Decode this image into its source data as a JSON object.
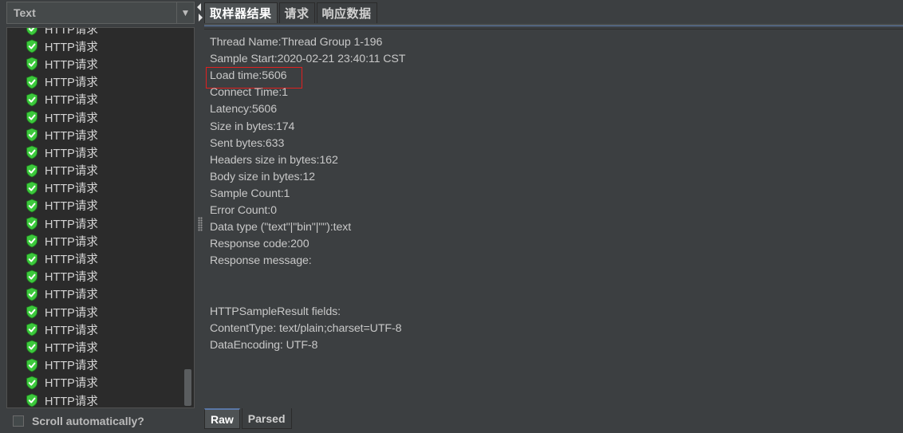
{
  "renderer": {
    "selected": "Text"
  },
  "tree": {
    "items": [
      {
        "label": "HTTP请求"
      },
      {
        "label": "HTTP请求"
      },
      {
        "label": "HTTP请求"
      },
      {
        "label": "HTTP请求"
      },
      {
        "label": "HTTP请求"
      },
      {
        "label": "HTTP请求"
      },
      {
        "label": "HTTP请求"
      },
      {
        "label": "HTTP请求"
      },
      {
        "label": "HTTP请求"
      },
      {
        "label": "HTTP请求"
      },
      {
        "label": "HTTP请求"
      },
      {
        "label": "HTTP请求"
      },
      {
        "label": "HTTP请求"
      },
      {
        "label": "HTTP请求"
      },
      {
        "label": "HTTP请求"
      },
      {
        "label": "HTTP请求"
      },
      {
        "label": "HTTP请求"
      },
      {
        "label": "HTTP请求"
      },
      {
        "label": "HTTP请求"
      },
      {
        "label": "HTTP请求"
      },
      {
        "label": "HTTP请求"
      },
      {
        "label": "HTTP请求"
      },
      {
        "label": "HTTP请求",
        "selected": true
      }
    ],
    "icon": "success-shield-icon",
    "icon_color": "#3cc93c"
  },
  "scroll_automatically": {
    "label": "Scroll automatically?",
    "checked": false
  },
  "tabs": [
    {
      "label": "取样器结果",
      "active": true
    },
    {
      "label": "请求",
      "active": false
    },
    {
      "label": "响应数据",
      "active": false
    }
  ],
  "result": {
    "lines": [
      "Thread Name:Thread Group 1-196",
      "Sample Start:2020-02-21 23:40:11 CST",
      "Load time:5606",
      "Connect Time:1",
      "Latency:5606",
      "Size in bytes:174",
      "Sent bytes:633",
      "Headers size in bytes:162",
      "Body size in bytes:12",
      "Sample Count:1",
      "Error Count:0",
      "Data type (\"text\"|\"bin\"|\"\"):text",
      "Response code:200",
      "Response message:",
      "",
      "",
      "HTTPSampleResult fields:",
      "ContentType: text/plain;charset=UTF-8",
      "DataEncoding: UTF-8"
    ]
  },
  "bottom_tabs": [
    {
      "label": "Raw",
      "active": true
    },
    {
      "label": "Parsed",
      "active": false
    }
  ],
  "colors": {
    "highlight_box": "#e02020",
    "selection": "#4b6eaf"
  }
}
